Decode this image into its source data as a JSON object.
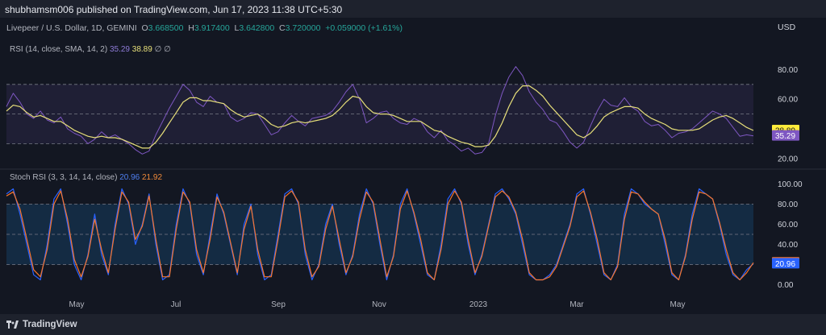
{
  "header": {
    "publisher": "shubhamsm006 published on TradingView.com, Jun 17, 2023 11:38 UTC+5:30"
  },
  "symbol": {
    "name": "Livepeer / U.S. Dollar, 1D, GEMINI",
    "o_label": "O",
    "o": "3.668500",
    "h_label": "H",
    "h": "3.917400",
    "l_label": "L",
    "l": "3.642800",
    "c_label": "C",
    "c": "3.720000",
    "change": "+0.059000 (+1.61%)",
    "currency": "USD"
  },
  "rsi_legend": {
    "label": "RSI (14, close, SMA, 14, 2)",
    "rsi": "35.29",
    "sma": "38.89",
    "extra": "∅ ∅"
  },
  "stoch_legend": {
    "label": "Stoch RSI (3, 3, 14, 14, close)",
    "k": "20.96",
    "d": "21.92"
  },
  "footer": {
    "brand": "TradingView"
  },
  "colors": {
    "background": "#131722",
    "rsi_line": "#7e57c2",
    "rsi_sma": "#e8e07a",
    "stoch_k": "#2962ff",
    "stoch_d": "#f7752b",
    "rsi_band": "#7e57c2",
    "stoch_band": "#2196f3"
  },
  "chart_data": [
    {
      "type": "line",
      "title": "RSI (14, close, SMA, 14, 2)",
      "x_ticks": [
        "May",
        "Jul",
        "Sep",
        "Nov",
        "2023",
        "Mar",
        "May"
      ],
      "y_ticks": [
        "20.00",
        "40.00",
        "60.00",
        "80.00"
      ],
      "ylim": [
        15,
        90
      ],
      "bands": [
        30,
        50,
        70
      ],
      "last_labels": [
        "38.89",
        "35.29"
      ],
      "series": [
        {
          "name": "RSI",
          "values": [
            55,
            64,
            58,
            50,
            47,
            52,
            46,
            44,
            48,
            40,
            37,
            35,
            30,
            33,
            38,
            34,
            36,
            33,
            30,
            26,
            23,
            25,
            36,
            45,
            54,
            62,
            70,
            66,
            58,
            55,
            62,
            58,
            57,
            48,
            45,
            47,
            51,
            50,
            43,
            36,
            38,
            44,
            49,
            45,
            42,
            47,
            48,
            49,
            52,
            58,
            65,
            70,
            60,
            44,
            47,
            51,
            52,
            47,
            44,
            43,
            47,
            45,
            38,
            34,
            39,
            32,
            29,
            25,
            27,
            23,
            24,
            30,
            49,
            64,
            75,
            82,
            76,
            65,
            58,
            53,
            46,
            44,
            38,
            31,
            27,
            31,
            42,
            52,
            60,
            56,
            55,
            61,
            55,
            52,
            45,
            42,
            43,
            39,
            34,
            37,
            38,
            40,
            44,
            48,
            52,
            50,
            47,
            41,
            35,
            36,
            35.29
          ]
        },
        {
          "name": "SMA",
          "values": [
            52,
            56,
            55,
            51,
            48,
            49,
            47,
            45,
            45,
            42,
            39,
            37,
            35,
            34,
            35,
            34,
            34,
            33,
            31,
            29,
            27,
            27,
            31,
            37,
            44,
            51,
            58,
            61,
            61,
            59,
            59,
            58,
            57,
            53,
            50,
            48,
            49,
            50,
            47,
            43,
            41,
            42,
            44,
            45,
            44,
            45,
            46,
            47,
            49,
            53,
            58,
            62,
            61,
            55,
            51,
            50,
            50,
            49,
            47,
            45,
            45,
            45,
            42,
            39,
            38,
            35,
            33,
            31,
            30,
            28,
            28,
            29,
            35,
            44,
            55,
            64,
            69,
            69,
            66,
            62,
            56,
            51,
            46,
            41,
            36,
            34,
            37,
            42,
            48,
            51,
            53,
            55,
            55,
            54,
            50,
            47,
            45,
            43,
            40,
            39,
            39,
            39,
            40,
            43,
            46,
            48,
            49,
            47,
            44,
            41,
            38.89
          ]
        }
      ]
    },
    {
      "type": "line",
      "title": "Stoch RSI (3, 3, 14, 14, close)",
      "x_ticks": [
        "May",
        "Jul",
        "Sep",
        "Nov",
        "2023",
        "Mar",
        "May"
      ],
      "y_ticks": [
        "0.00",
        "20.00",
        "40.00",
        "60.00",
        "80.00",
        "100.00"
      ],
      "ylim": [
        -5,
        105
      ],
      "bands": [
        20,
        50,
        80
      ],
      "last_labels": [
        "21.92",
        "20.96"
      ],
      "series": [
        {
          "name": "%K",
          "values": [
            90,
            95,
            70,
            40,
            10,
            5,
            40,
            85,
            95,
            60,
            20,
            5,
            30,
            70,
            30,
            10,
            60,
            95,
            80,
            40,
            60,
            90,
            40,
            5,
            10,
            60,
            95,
            80,
            30,
            10,
            50,
            90,
            70,
            40,
            10,
            60,
            80,
            30,
            5,
            10,
            50,
            90,
            95,
            80,
            30,
            5,
            20,
            60,
            80,
            40,
            10,
            30,
            70,
            95,
            80,
            40,
            5,
            30,
            80,
            95,
            70,
            40,
            10,
            5,
            40,
            85,
            95,
            80,
            40,
            10,
            30,
            60,
            90,
            95,
            85,
            70,
            40,
            10,
            5,
            5,
            10,
            20,
            40,
            60,
            90,
            95,
            70,
            40,
            10,
            5,
            20,
            70,
            95,
            90,
            80,
            75,
            70,
            40,
            10,
            5,
            30,
            70,
            95,
            90,
            85,
            60,
            30,
            10,
            5,
            15,
            20.96
          ]
        },
        {
          "name": "%D",
          "values": [
            88,
            92,
            75,
            45,
            15,
            8,
            35,
            80,
            93,
            65,
            25,
            8,
            28,
            65,
            35,
            12,
            55,
            92,
            82,
            45,
            58,
            88,
            45,
            8,
            8,
            55,
            92,
            82,
            35,
            12,
            45,
            87,
            72,
            42,
            12,
            55,
            78,
            35,
            8,
            8,
            45,
            87,
            93,
            82,
            35,
            8,
            18,
            55,
            78,
            45,
            12,
            28,
            65,
            92,
            82,
            45,
            8,
            28,
            75,
            93,
            72,
            45,
            12,
            5,
            35,
            80,
            93,
            82,
            45,
            12,
            28,
            58,
            87,
            93,
            87,
            72,
            45,
            12,
            5,
            5,
            8,
            18,
            38,
            58,
            87,
            93,
            72,
            45,
            12,
            5,
            18,
            65,
            92,
            90,
            82,
            75,
            70,
            45,
            12,
            5,
            28,
            65,
            92,
            90,
            85,
            62,
            35,
            12,
            5,
            12,
            21.92
          ]
        }
      ]
    }
  ]
}
